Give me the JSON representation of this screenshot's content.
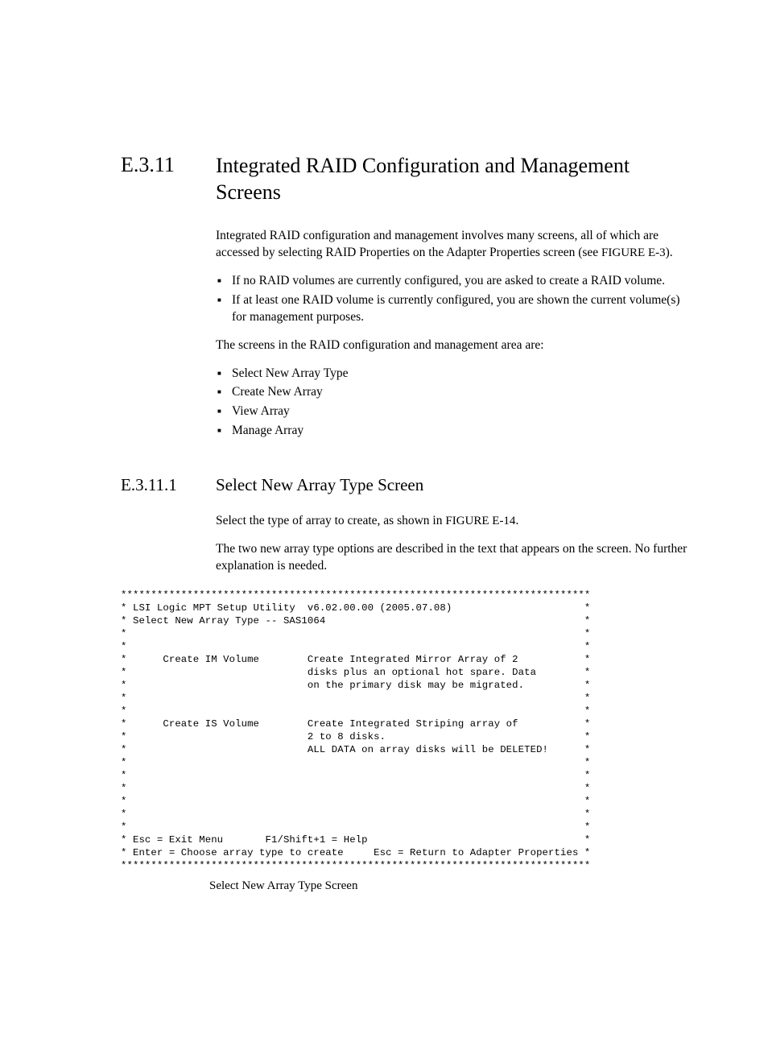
{
  "section": {
    "number": "E.3.11",
    "title": "Integrated RAID Configuration and Management Screens",
    "intro": "Integrated RAID configuration and management involves many screens, all of which are accessed by selecting RAID Properties on the Adapter Properties screen (see ",
    "intro_ref": "FIGURE E-3",
    "intro_tail": ").",
    "bullets1": [
      "If no RAID volumes are currently configured, you are asked to create a RAID volume.",
      "If at least one RAID volume is currently configured, you are shown the current volume(s) for management purposes."
    ],
    "para2": "The screens in the RAID configuration and management area are:",
    "bullets2": [
      "Select New Array Type",
      "Create New Array",
      "View Array",
      "Manage Array"
    ]
  },
  "subsection": {
    "number": "E.3.11.1",
    "title": "Select New Array Type Screen",
    "para1a": "Select the type of array to create, as shown in ",
    "para1_ref": "FIGURE E-14",
    "para1b": ".",
    "para2": "The two new array type options are described in the text that appears on the screen. No further explanation is needed."
  },
  "terminal": {
    "border": "******************************************************************************",
    "header1": "* LSI Logic MPT Setup Utility  v6.02.00.00 (2005.07.08)                      *",
    "header2": "* Select New Array Type -- SAS1064                                           *",
    "blank": "*                                                                            *",
    "im1": "*      Create IM Volume        Create Integrated Mirror Array of 2           *",
    "im2": "*                              disks plus an optional hot spare. Data        *",
    "im3": "*                              on the primary disk may be migrated.          *",
    "is1": "*      Create IS Volume        Create Integrated Striping array of           *",
    "is2": "*                              2 to 8 disks.                                 *",
    "is3": "*                              ALL DATA on array disks will be DELETED!      *",
    "help": "* Esc = Exit Menu       F1/Shift+1 = Help                                    *",
    "footer": "* Enter = Choose array type to create     Esc = Return to Adapter Properties *"
  },
  "figcaption": "Select New Array Type Screen"
}
